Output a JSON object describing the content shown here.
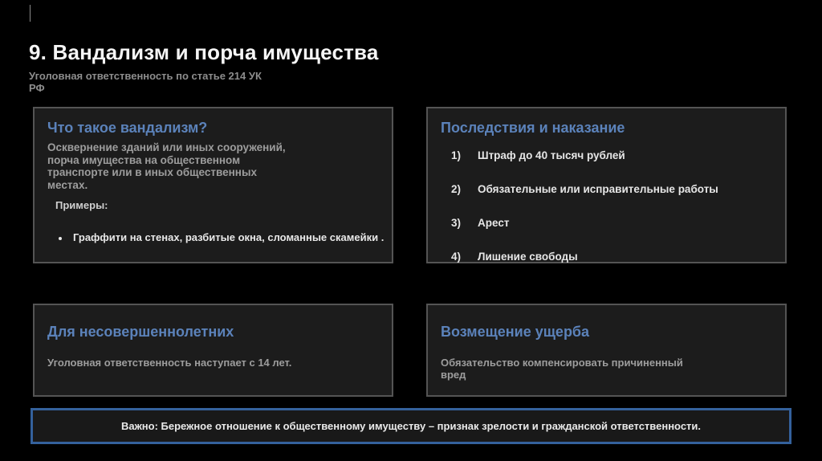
{
  "page": {
    "title": "9. Вандализм и порча имущества",
    "subtitle": "Уголовная ответственность по статье 214 УК\nРФ"
  },
  "colors": {
    "accent_blue": "#5b82ba",
    "banner_border_blue": "#34619c",
    "card_background": "#1c1c1c",
    "card_border": "#545454",
    "page_background": "#000000"
  },
  "cards": {
    "what_is": {
      "heading": "Что такое вандализм?",
      "body": "Осквернение зданий или иных сооружений,\nпорча имущества на общественном\nтранспорте или в иных общественных\nместах.",
      "examples_label": "Примеры:",
      "bullet_icon": "dot",
      "bullet_text": "Граффити на стенах, разбитые окна, сломанные скамейки ."
    },
    "consequences": {
      "heading": "Последствия и наказание",
      "items": [
        {
          "num": "1)",
          "text": "Штраф до 40 тысяч рублей"
        },
        {
          "num": "2)",
          "text": "Обязательные или исправительные работы"
        },
        {
          "num": "3)",
          "text": "Арест"
        },
        {
          "num": "4)",
          "text": "Лишение свободы"
        }
      ]
    },
    "minors": {
      "heading": "Для несовершеннолетних",
      "body": "Уголовная ответственность наступает с 14 лет."
    },
    "compensation": {
      "heading": "Возмещение ущерба",
      "body": "Обязательство компенсировать причиненный\nвред"
    }
  },
  "banner": {
    "text": "Важно: Бережное отношение к общественному имуществу – признак зрелости и гражданской ответственности."
  }
}
